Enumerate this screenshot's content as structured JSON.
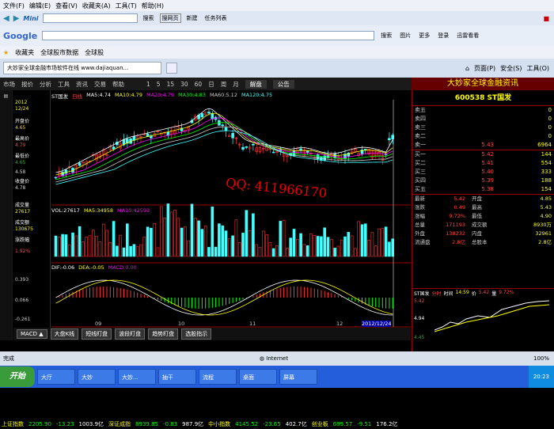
{
  "ie": {
    "menu": [
      "文件(F)",
      "编辑(E)",
      "查看(V)",
      "收藏夹(A)",
      "工具(T)",
      "帮助(H)"
    ],
    "search_label": "Mini",
    "search_btn": "搜索",
    "web_btn": "搜网页",
    "new_btn": "新建",
    "tasks_btn": "任务列表",
    "google_label": "Google",
    "google_search": "搜索",
    "more": "更多",
    "login": "登录",
    "pictures": "图片",
    "options": "迅雷看看",
    "fav_label": "收藏夹",
    "fav_items": [
      "全球股市数据",
      "全球股"
    ],
    "tab_title": "大妙家全球金融市场软件在线 www.dajiaquan...",
    "page_menu": "页面(P)",
    "safety": "安全(S)",
    "tools": "工具(O)"
  },
  "app": {
    "menu": [
      "市场",
      "报价",
      "分析",
      "工具",
      "资讯",
      "交易",
      "帮助"
    ],
    "nums": [
      "1",
      "5",
      "15",
      "30",
      "60",
      "日",
      "周",
      "月"
    ],
    "jiepan": "解盘",
    "gonggao": "公告",
    "banner": "大妙家全球金融资讯",
    "sidebar": [
      "分时",
      "开盘价",
      "最高价",
      "最低价",
      "收盘价",
      "成交量",
      "成交额",
      "涨跌幅"
    ],
    "info1": [
      "ST国发",
      "日线",
      "MA5:4.74",
      "MA10:4.79",
      "MA20:4.79",
      "MA30:4.83",
      "MA60:5.12",
      "MA120:4.75"
    ],
    "info2": [
      "VOL:27617",
      "MA5:34958",
      "MA10:42593"
    ],
    "info3": [
      "DIF:-0.06",
      "DEA:-0.05",
      "MACD:0.00"
    ],
    "yaxis": {
      "date": "2012",
      "date2": "12/24",
      "labels": [
        "4.65",
        "4.79",
        "4.65",
        "4.58",
        "4.53",
        "4.78",
        "27617",
        "130675",
        "1.92%",
        "0.393",
        "0.066",
        "-0.261"
      ]
    },
    "x_ticks": [
      "09",
      "10",
      "11",
      "12",
      "2012/12/24"
    ],
    "bottom_tabs": [
      "MACD ▲",
      "大盘K线",
      "短线盯盘",
      "波段盯盘",
      "趋势盯盘",
      "选股指示"
    ],
    "stock_title": "600538 ST国发",
    "asks": [
      {
        "l": "卖五",
        "p": "",
        "v": "0"
      },
      {
        "l": "卖四",
        "p": "",
        "v": "0"
      },
      {
        "l": "卖三",
        "p": "",
        "v": "0"
      },
      {
        "l": "卖二",
        "p": "",
        "v": "0"
      },
      {
        "l": "卖一",
        "p": "5.43",
        "v": "6964"
      }
    ],
    "bids": [
      {
        "l": "买一",
        "p": "5.42",
        "v": "144"
      },
      {
        "l": "买二",
        "p": "5.41",
        "v": "554"
      },
      {
        "l": "买三",
        "p": "5.40",
        "v": "333"
      },
      {
        "l": "买四",
        "p": "5.39",
        "v": "188"
      },
      {
        "l": "买五",
        "p": "5.38",
        "v": "154"
      }
    ],
    "stats": [
      [
        "最新",
        "5.42",
        "开盘",
        "4.85"
      ],
      [
        "涨跌",
        "0.49",
        "最高",
        "5.43"
      ],
      [
        "涨幅",
        "9.72%",
        "最低",
        "4.90"
      ],
      [
        "总量",
        "171193",
        "成交额",
        "8930万"
      ],
      [
        "外盘",
        "138232",
        "内盘",
        "32961"
      ],
      [
        "流通盘",
        "2.8亿",
        "总股本",
        "2.8亿"
      ]
    ],
    "mini_header": [
      "ST国发",
      "分时",
      "时间",
      "14:59",
      "价",
      "5.42",
      "量",
      "9.72%"
    ],
    "mini_y": [
      "5.42",
      "4.94",
      "4.45"
    ],
    "ticker": [
      "上证指数",
      "2205.90",
      "-13.23",
      "1003.9亿",
      "深证成指",
      "8939.85",
      "-0.83",
      "987.9亿",
      "中小指数",
      "4145.52",
      "-23.65",
      "402.7亿",
      "创业板",
      "699.57",
      "-9.51",
      "176.2亿"
    ],
    "qq": "QQ:  411966170"
  },
  "status": {
    "left": "完成",
    "zone": "Internet",
    "zoom": "100%"
  },
  "taskbar": {
    "start": "开始",
    "tasks": [
      "大厅",
      "大妙",
      "大妙...",
      "抽干",
      "流程",
      "桌面",
      "屏幕"
    ],
    "clock": "20:23"
  },
  "chart_data": {
    "type": "candlestick",
    "title": "ST国发 日线",
    "x_ticks": [
      "09",
      "10",
      "11",
      "12"
    ],
    "ylim": [
      3.5,
      6.5
    ],
    "series": [
      {
        "name": "MA5",
        "values": [
          4.74
        ]
      },
      {
        "name": "MA10",
        "values": [
          4.79
        ]
      },
      {
        "name": "MA20",
        "values": [
          4.79
        ]
      },
      {
        "name": "MA30",
        "values": [
          4.83
        ]
      },
      {
        "name": "MA60",
        "values": [
          5.12
        ]
      },
      {
        "name": "MA120",
        "values": [
          4.75
        ]
      }
    ],
    "volume_label": "VOL",
    "macd": {
      "dif": -0.06,
      "dea": -0.05,
      "macd": 0.0
    }
  }
}
